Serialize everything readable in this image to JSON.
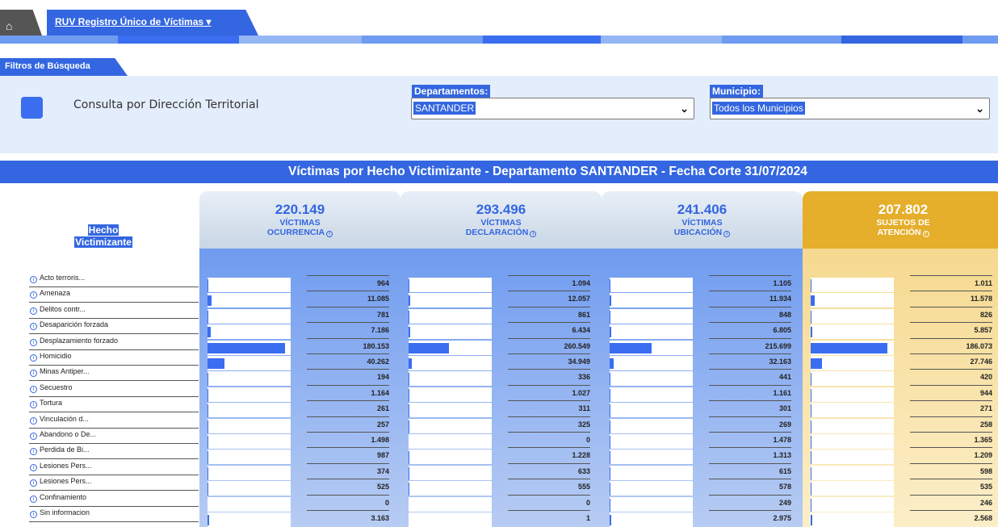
{
  "nav": {
    "home_icon": "home-icon",
    "ruv_tab_label": "RUV Registro Único de Víctimas ▾"
  },
  "colors": {
    "primary_blue": "#3366e0",
    "panel_bg": "#e3edfb",
    "gold": "#e5ae2b",
    "gold_light": "#f6d98f"
  },
  "filters": {
    "tab_label": "Filtros de Búsqueda",
    "direccion_label": "Consulta por Dirección Territorial",
    "departamentos_label": "Departamentos:",
    "departamentos_value": "SANTANDER",
    "municipio_label": "Municipio:",
    "municipio_value": "Todos los Municipios"
  },
  "title": "Víctimas por Hecho Victimizante - Departamento SANTANDER - Fecha Corte 31/07/2024",
  "table": {
    "row_header_line1": "Hecho",
    "row_header_line2": "Victimizante",
    "rows": [
      "Acto terroris...",
      "Amenaza",
      "Delitos contr...",
      "Desaparición forzada",
      "Desplazamiento forzado",
      "Homicidio",
      "Minas Antiper...",
      "Secuestro",
      "Tortura",
      "Vinculación d...",
      "Abandono o De...",
      "Perdida de Bi...",
      "Lesiones Pers...",
      "Lesiones Pers...",
      "Confinamiento",
      "Sin informacion"
    ],
    "columns": [
      {
        "total": "220.149",
        "label_line1": "VÍCTIMAS",
        "label_line2": "OCURRENCIA",
        "values": [
          "964",
          "11.085",
          "781",
          "7.186",
          "180.153",
          "40.262",
          "194",
          "1.164",
          "261",
          "257",
          "1.498",
          "987",
          "374",
          "525",
          "0",
          "3.163"
        ],
        "bar_fraction": [
          0.005,
          0.05,
          0.004,
          0.04,
          0.93,
          0.2,
          0.001,
          0.006,
          0.001,
          0.001,
          0.008,
          0.005,
          0.002,
          0.003,
          0,
          0.016
        ]
      },
      {
        "total": "293.496",
        "label_line1": "VÍCTIMAS",
        "label_line2": "DECLARACIÓN",
        "values": [
          "1.094",
          "12.057",
          "861",
          "6.434",
          "260.549",
          "34.949",
          "336",
          "1.027",
          "311",
          "325",
          "0",
          "1.228",
          "633",
          "555",
          "0",
          "1"
        ],
        "bar_fraction": [
          0.004,
          0.02,
          0.003,
          0.01,
          0.49,
          0.035,
          0.001,
          0.004,
          0.001,
          0.001,
          0,
          0.005,
          0.002,
          0.002,
          0,
          0
        ]
      },
      {
        "total": "241.406",
        "label_line1": "VÍCTIMAS",
        "label_line2": "UBICACIÓN",
        "values": [
          "1.105",
          "11.934",
          "848",
          "6.805",
          "215.699",
          "32.163",
          "441",
          "1.161",
          "301",
          "269",
          "1.478",
          "1.313",
          "615",
          "578",
          "249",
          "2.975"
        ],
        "bar_fraction": [
          0.005,
          0.02,
          0.004,
          0.015,
          0.5,
          0.05,
          0.002,
          0.005,
          0.001,
          0.001,
          0.007,
          0.006,
          0.003,
          0.003,
          0.001,
          0.014
        ]
      },
      {
        "total": "207.802",
        "label_line1": "SUJETOS DE",
        "label_line2": "ATENCIÓN",
        "values": [
          "1.011",
          "11.578",
          "826",
          "5.857",
          "186.073",
          "27.746",
          "420",
          "944",
          "271",
          "258",
          "1.365",
          "1.209",
          "598",
          "535",
          "246",
          "2.568"
        ],
        "bar_fraction": [
          0.005,
          0.05,
          0.004,
          0.02,
          0.92,
          0.14,
          0.002,
          0.005,
          0.001,
          0.001,
          0.007,
          0.006,
          0.003,
          0.003,
          0.001,
          0.013
        ]
      }
    ]
  }
}
